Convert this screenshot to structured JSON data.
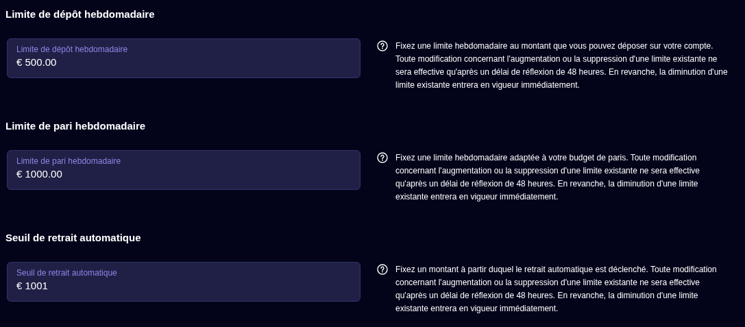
{
  "sections": [
    {
      "title": "Limite de dépôt hebdomadaire",
      "field": {
        "label": "Limite de dépôt hebdomadaire",
        "value": "€ 500.00"
      },
      "help": "Fixez une limite hebdomadaire au montant que vous pouvez déposer sur votre compte. Toute modification concernant l'augmentation ou la suppression d'une limite existante ne sera effective qu'après un délai de réflexion de 48 heures. En revanche, la diminution d'une limite existante entrera en vigueur immédiatement."
    },
    {
      "title": "Limite de pari hebdomadaire",
      "field": {
        "label": "Limite de pari hebdomadaire",
        "value": "€ 1000.00"
      },
      "help": "Fixez une limite hebdomadaire adaptée à votre budget de paris. Toute modification concernant l'augmentation ou la suppression d'une limite existante ne sera effective qu'après un délai de réflexion de 48 heures. En revanche, la diminution d'une limite existante entrera en vigueur immédiatement."
    },
    {
      "title": "Seuil de retrait automatique",
      "field": {
        "label": "Seuil de retrait automatique",
        "value": "€ 1001"
      },
      "help": "Fixez un montant à partir duquel le retrait automatique est déclenché. Toute modification concernant l'augmentation ou la suppression d'une limite existante ne sera effective qu'après un délai de réflexion de 48 heures. En revanche, la diminution d'une limite existante entrera en vigueur immédiatement."
    }
  ]
}
